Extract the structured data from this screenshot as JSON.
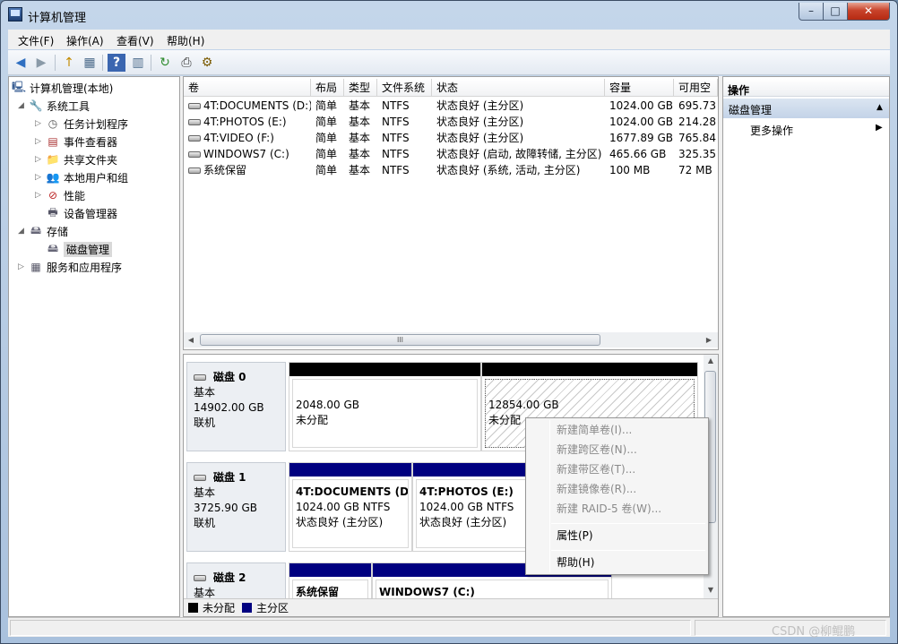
{
  "window": {
    "title": "计算机管理"
  },
  "menu": [
    "文件(F)",
    "操作(A)",
    "查看(V)",
    "帮助(H)"
  ],
  "toolbar": {
    "back": "◀",
    "forward": "▶",
    "up": "↑",
    "show_hide": "▦",
    "help": "?",
    "pane": "▥",
    "refresh": "↻",
    "export": "⎙",
    "properties": "⚙"
  },
  "tree": {
    "root": "计算机管理(本地)",
    "system_tools": "系统工具",
    "task_scheduler": "任务计划程序",
    "event_viewer": "事件查看器",
    "shared_folders": "共享文件夹",
    "local_users": "本地用户和组",
    "performance": "性能",
    "device_manager": "设备管理器",
    "storage": "存储",
    "disk_management": "磁盘管理",
    "services": "服务和应用程序"
  },
  "volumes": {
    "columns": [
      "卷",
      "布局",
      "类型",
      "文件系统",
      "状态",
      "容量",
      "可用空"
    ],
    "rows": [
      {
        "name": "4T:DOCUMENTS (D:)",
        "layout": "简单",
        "type": "基本",
        "fs": "NTFS",
        "status": "状态良好 (主分区)",
        "capacity": "1024.00 GB",
        "free": "695.73"
      },
      {
        "name": "4T:PHOTOS (E:)",
        "layout": "简单",
        "type": "基本",
        "fs": "NTFS",
        "status": "状态良好 (主分区)",
        "capacity": "1024.00 GB",
        "free": "214.28"
      },
      {
        "name": "4T:VIDEO (F:)",
        "layout": "简单",
        "type": "基本",
        "fs": "NTFS",
        "status": "状态良好 (主分区)",
        "capacity": "1677.89 GB",
        "free": "765.84"
      },
      {
        "name": "WINDOWS7 (C:)",
        "layout": "简单",
        "type": "基本",
        "fs": "NTFS",
        "status": "状态良好 (启动, 故障转储, 主分区)",
        "capacity": "465.66 GB",
        "free": "325.35"
      },
      {
        "name": "系统保留",
        "layout": "简单",
        "type": "基本",
        "fs": "NTFS",
        "status": "状态良好 (系统, 活动, 主分区)",
        "capacity": "100 MB",
        "free": "72 MB"
      }
    ],
    "scroll_grip": "III"
  },
  "disks": [
    {
      "name": "磁盘 0",
      "type": "基本",
      "size": "14902.00 GB",
      "state": "联机",
      "partitions": [
        {
          "size": "2048.00 GB",
          "label": "未分配"
        },
        {
          "size": "12854.00 GB",
          "label": "未分配"
        }
      ]
    },
    {
      "name": "磁盘 1",
      "type": "基本",
      "size": "3725.90 GB",
      "state": "联机",
      "partitions": [
        {
          "name": "4T:DOCUMENTS (D",
          "size": "1024.00 GB NTFS",
          "status": "状态良好 (主分区)"
        },
        {
          "name": "4T:PHOTOS (E:)",
          "size": "1024.00 GB NTFS",
          "status": "状态良好 (主分区)"
        }
      ]
    },
    {
      "name": "磁盘 2",
      "type": "基本",
      "partitions": [
        {
          "name": "系统保留"
        },
        {
          "name": "WINDOWS7 (C:)"
        }
      ]
    }
  ],
  "legend": {
    "unallocated": "未分配",
    "primary": "主分区",
    "unallocated_color": "#000000",
    "primary_color": "#000080"
  },
  "actions": {
    "header": "操作",
    "section": "磁盘管理",
    "more": "更多操作"
  },
  "context_menu": {
    "new_simple": "新建简单卷(I)...",
    "new_spanned": "新建跨区卷(N)...",
    "new_striped": "新建带区卷(T)...",
    "new_mirrored": "新建镜像卷(R)...",
    "new_raid5": "新建 RAID-5 卷(W)...",
    "properties": "属性(P)",
    "help": "帮助(H)"
  },
  "watermark": "CSDN @柳鲲鹏"
}
